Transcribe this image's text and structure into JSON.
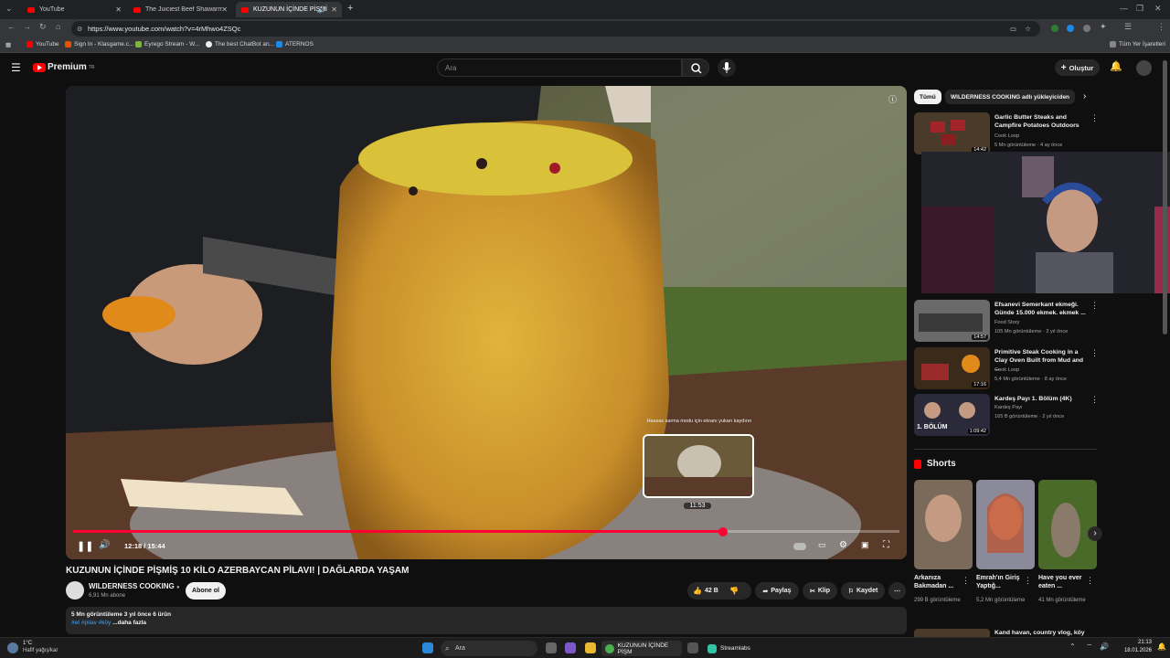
{
  "browser": {
    "tabs": [
      {
        "label": "YouTube"
      },
      {
        "label": "The Juiciest Beef Shawarma wit"
      },
      {
        "label": "KUZUNUN İÇİNDE PİŞMİ"
      }
    ],
    "url": "https://www.youtube.com/watch?v=4rMhwo4ZSQc",
    "bookmarks": [
      {
        "label": "YouTube"
      },
      {
        "label": "Sign In - Klasgame.c..."
      },
      {
        "label": "Eyrego Stream - W..."
      },
      {
        "label": "The best ChatBot an..."
      },
      {
        "label": "ATERNOS"
      }
    ],
    "all_bookmarks": "Tüm Yer İşaretleri"
  },
  "youtube": {
    "logo_text": "Premium",
    "logo_region": "TR",
    "search_placeholder": "Ara",
    "create_label": "Oluştur"
  },
  "player": {
    "time_display": "12:18 / 15:44",
    "progress": 0.787,
    "hover_tip": "Hassas sarma modu için ekranı yukarı kaydırın",
    "hover_time": "11:53"
  },
  "video": {
    "title": "KUZUNUN İÇİNDE PİŞMİŞ 10 KİLO AZERBAYCAN PİLAVI! | DAĞLARDA YAŞAM",
    "channel": "WILDERNESS COOKING",
    "subscribers": "6,91 Mn abone",
    "subscribe_label": "Abone ol",
    "likes": "42 B",
    "share_label": "Paylaş",
    "clip_label": "Klip",
    "save_label": "Kaydet",
    "desc_stats": "5 Mn görüntüleme  3 yıl önce  6 ürün",
    "desc_tags": "#et #pilav #köy",
    "desc_more": "...daha fazla"
  },
  "sidebar": {
    "chips": [
      "Tümü",
      "WILDERNESS COOKING adlı yükleyiciden"
    ],
    "videos": [
      {
        "title": "Garlic Butter Steaks and Campfire Potatoes Outdoors",
        "channel": "Cook Loop",
        "meta": "5 Mn görüntüleme · 4 ay önce",
        "duration": "14:42"
      },
      {
        "title": "Efsanevi Semerkant ekmeği. Günde 15.000 ekmek. ekmek ...",
        "channel": "Food Story",
        "meta": "105 Mn görüntüleme · 3 yıl önce",
        "duration": "14:57"
      },
      {
        "title": "Primitive Steak Cooking in a Clay Oven Built from Mud and ...",
        "channel": "Cook Loop",
        "meta": "5,4 Mn görüntüleme · 8 ay önce",
        "duration": "17:16"
      },
      {
        "title": "Kardeş Payı 1. Bölüm (4K)",
        "channel": "Kardeş Payı",
        "meta": "165 B görüntüleme · 2 yıl önce",
        "duration": "1:09:42",
        "thumb_text": "1. BÖLÜM"
      }
    ],
    "shorts_heading": "Shorts",
    "shorts": [
      {
        "title": "Arkanıza Bakmadan ...",
        "views": "299 B görüntüleme"
      },
      {
        "title": "Emrah'ın Giriş Yaptığ...",
        "views": "5,2 Mn görüntüleme"
      },
      {
        "title": "Have you ever eaten ...",
        "views": "41 Mn görüntüleme"
      }
    ],
    "next_partial_title": "Kand havan, country vlog, köy"
  },
  "taskbar": {
    "weather_temp": "1°C",
    "weather_desc": "Hafif yağış/kar",
    "search_label": "Ara",
    "app_chrome_label": "KUZUNUN İÇİNDE PİŞM",
    "app_streamlabs_label": "Streamlabs",
    "time": "21:13",
    "date": "18.01.2026"
  },
  "colors": {
    "youtube_red": "#ff0000",
    "progress_red": "#ff0033",
    "bg": "#0f0f0f"
  }
}
